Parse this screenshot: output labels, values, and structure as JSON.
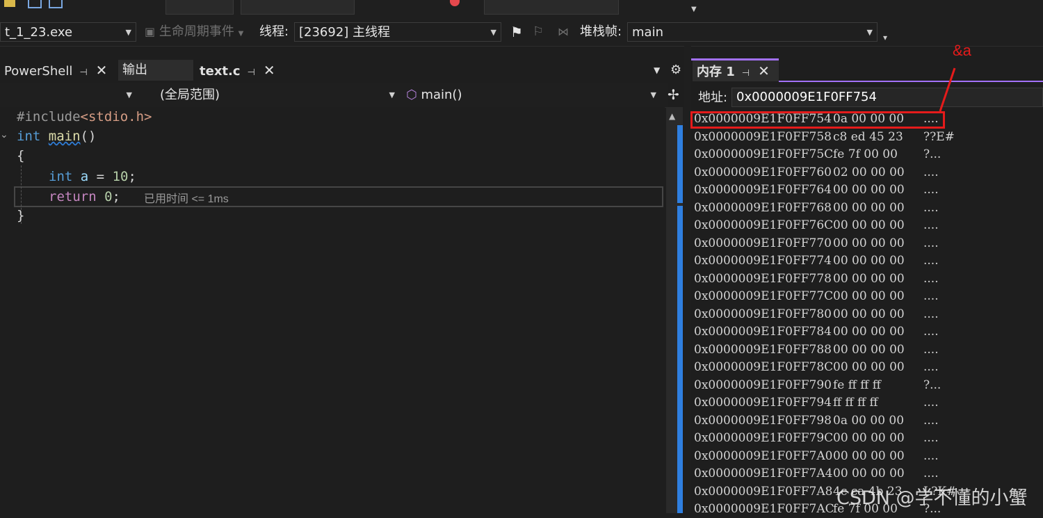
{
  "toolbar": {
    "process": "t_1_23.exe",
    "lifecycle_label": "生命周期事件",
    "thread_label": "线程:",
    "thread_value": "[23692] 主线程",
    "stackframe_label": "堆栈帧:",
    "stackframe_value": "main"
  },
  "tabs": {
    "powershell": "PowerShell",
    "output": "输出",
    "textc": "text.c",
    "memory": "内存 1"
  },
  "navbar": {
    "scope": "(全局范围)",
    "function": "main()"
  },
  "code": {
    "include": "#include",
    "header": "<stdio.h>",
    "int1": "int",
    "main": "main",
    "parens": "()",
    "brace_open": "{",
    "int2": "int",
    "var_a": "a",
    "assign": " = ",
    "ten": "10",
    "semi1": ";",
    "ret": "return",
    "zero": "0",
    "semi2": ";",
    "elapsed": "已用时间 <= 1ms",
    "brace_close": "}"
  },
  "memory": {
    "address_label": "地址:",
    "address_value": "0x0000009E1F0FF754",
    "annotation": "&a",
    "rows": [
      {
        "addr": "0x0000009E1F0FF754",
        "bytes": "0a 00 00 00",
        "ascii": "...."
      },
      {
        "addr": "0x0000009E1F0FF758",
        "bytes": "c8 ed 45 23",
        "ascii": "??E#"
      },
      {
        "addr": "0x0000009E1F0FF75C",
        "bytes": "fe 7f 00 00",
        "ascii": "?..."
      },
      {
        "addr": "0x0000009E1F0FF760",
        "bytes": "02 00 00 00",
        "ascii": "...."
      },
      {
        "addr": "0x0000009E1F0FF764",
        "bytes": "00 00 00 00",
        "ascii": "...."
      },
      {
        "addr": "0x0000009E1F0FF768",
        "bytes": "00 00 00 00",
        "ascii": "...."
      },
      {
        "addr": "0x0000009E1F0FF76C",
        "bytes": "00 00 00 00",
        "ascii": "...."
      },
      {
        "addr": "0x0000009E1F0FF770",
        "bytes": "00 00 00 00",
        "ascii": "...."
      },
      {
        "addr": "0x0000009E1F0FF774",
        "bytes": "00 00 00 00",
        "ascii": "...."
      },
      {
        "addr": "0x0000009E1F0FF778",
        "bytes": "00 00 00 00",
        "ascii": "...."
      },
      {
        "addr": "0x0000009E1F0FF77C",
        "bytes": "00 00 00 00",
        "ascii": "...."
      },
      {
        "addr": "0x0000009E1F0FF780",
        "bytes": "00 00 00 00",
        "ascii": "...."
      },
      {
        "addr": "0x0000009E1F0FF784",
        "bytes": "00 00 00 00",
        "ascii": "...."
      },
      {
        "addr": "0x0000009E1F0FF788",
        "bytes": "00 00 00 00",
        "ascii": "...."
      },
      {
        "addr": "0x0000009E1F0FF78C",
        "bytes": "00 00 00 00",
        "ascii": "...."
      },
      {
        "addr": "0x0000009E1F0FF790",
        "bytes": "fe ff ff ff",
        "ascii": "?..."
      },
      {
        "addr": "0x0000009E1F0FF794",
        "bytes": "ff ff ff ff",
        "ascii": "...."
      },
      {
        "addr": "0x0000009E1F0FF798",
        "bytes": "0a 00 00 00",
        "ascii": "...."
      },
      {
        "addr": "0x0000009E1F0FF79C",
        "bytes": "00 00 00 00",
        "ascii": "...."
      },
      {
        "addr": "0x0000009E1F0FF7A0",
        "bytes": "00 00 00 00",
        "ascii": "...."
      },
      {
        "addr": "0x0000009E1F0FF7A4",
        "bytes": "00 00 00 00",
        "ascii": "...."
      },
      {
        "addr": "0x0000009E1F0FF7A8",
        "bytes": "4c ca 4b 23",
        "ascii": "L?K#"
      },
      {
        "addr": "0x0000009E1F0FF7AC",
        "bytes": "fe 7f 00 00",
        "ascii": "?..."
      }
    ]
  },
  "watermark": "CSDN @学不懂的小蟹",
  "colors": {
    "accent": "#a371f7",
    "annotation_red": "#e51b1b",
    "background": "#1e1e1e",
    "scrollbar": "#2f7fe0"
  }
}
